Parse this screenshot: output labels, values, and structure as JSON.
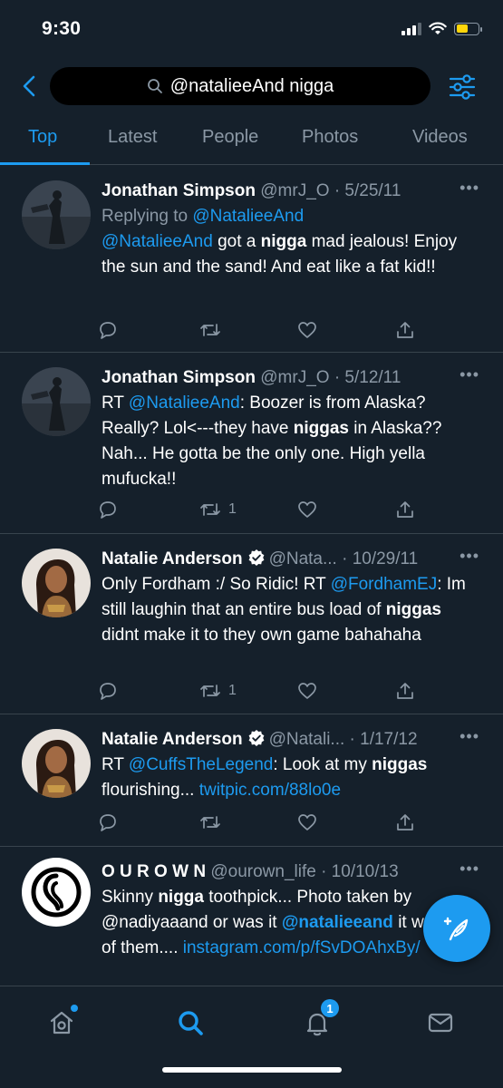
{
  "status_bar": {
    "time": "9:30",
    "battery_color": "#ffd60a"
  },
  "search": {
    "query": "@natalieeAnd nigga",
    "icons": [
      "back-chevron-icon",
      "search-icon",
      "filter-icon"
    ]
  },
  "tabs": [
    {
      "label": "Top",
      "active": true
    },
    {
      "label": "Latest",
      "active": false
    },
    {
      "label": "People",
      "active": false
    },
    {
      "label": "Photos",
      "active": false
    },
    {
      "label": "Videos",
      "active": false
    }
  ],
  "tweets": [
    {
      "name": "Jonathan Simpson",
      "meta": "@mrJ_O · 5/25/11",
      "replying_prefix": "Replying to ",
      "replying_handle": "@NatalieeAnd",
      "segments": [
        {
          "t": "@NatalieeAnd",
          "style": "link"
        },
        {
          "t": " got a ",
          "style": "plain"
        },
        {
          "t": "nigga",
          "style": "bold"
        },
        {
          "t": " mad jealous! Enjoy the sun and the sand!  And eat like a fat kid!!",
          "style": "plain"
        }
      ],
      "retweets": "",
      "more": "•••"
    },
    {
      "name": "Jonathan Simpson",
      "meta": "@mrJ_O · 5/12/11",
      "segments": [
        {
          "t": "RT ",
          "style": "plain"
        },
        {
          "t": "@NatalieeAnd",
          "style": "link"
        },
        {
          "t": ": Boozer is from Alaska? Really? Lol<---they have ",
          "style": "plain"
        },
        {
          "t": "niggas",
          "style": "bold"
        },
        {
          "t": " in Alaska??  Nah... He gotta be the only one. High yella mufucka!!",
          "style": "plain"
        }
      ],
      "retweets": "1",
      "more": "•••"
    },
    {
      "name": "Natalie Anderson",
      "verified": true,
      "meta": "@Nata... · 10/29/11",
      "segments": [
        {
          "t": "Only Fordham :/ So Ridic! RT ",
          "style": "plain"
        },
        {
          "t": "@FordhamEJ",
          "style": "link"
        },
        {
          "t": ": Im still laughin that an entire bus load of ",
          "style": "plain"
        },
        {
          "t": "niggas",
          "style": "bold"
        },
        {
          "t": " didnt make it to they own game bahahaha",
          "style": "plain"
        }
      ],
      "retweets": "1",
      "more": "•••"
    },
    {
      "name": "Natalie Anderson",
      "verified": true,
      "meta": "@Natali... · 1/17/12",
      "segments": [
        {
          "t": "RT ",
          "style": "plain"
        },
        {
          "t": "@CuffsTheLegend",
          "style": "link"
        },
        {
          "t": ": Look at my ",
          "style": "plain"
        },
        {
          "t": "niggas",
          "style": "bold"
        },
        {
          "t": " flourishing...  ",
          "style": "plain"
        },
        {
          "t": "twitpic.com/88lo0e",
          "style": "link"
        }
      ],
      "retweets": "",
      "more": "•••"
    },
    {
      "name": "O U R O W N",
      "meta": "@ourown_life · 10/10/13",
      "segments": [
        {
          "t": "Skinny ",
          "style": "plain"
        },
        {
          "t": "nigga",
          "style": "bold"
        },
        {
          "t": " toothpick... Photo taken by @nadiyaaand or was it ",
          "style": "plain"
        },
        {
          "t": "@natalieeand",
          "style": "linkbold"
        },
        {
          "t": " it was one of them.... ",
          "style": "plain"
        },
        {
          "t": "instagram.com/p/fSvDOAhxBy/",
          "style": "link"
        }
      ],
      "retweets": "",
      "more": "•••"
    }
  ],
  "bottom_nav": {
    "items": [
      "home-icon",
      "search-icon",
      "notifications-icon",
      "messages-icon"
    ],
    "notification_count": "1"
  },
  "colors": {
    "background": "#15202b",
    "accent": "#1d9bf0",
    "secondary_text": "#8b98a5",
    "divider": "#38444d"
  }
}
